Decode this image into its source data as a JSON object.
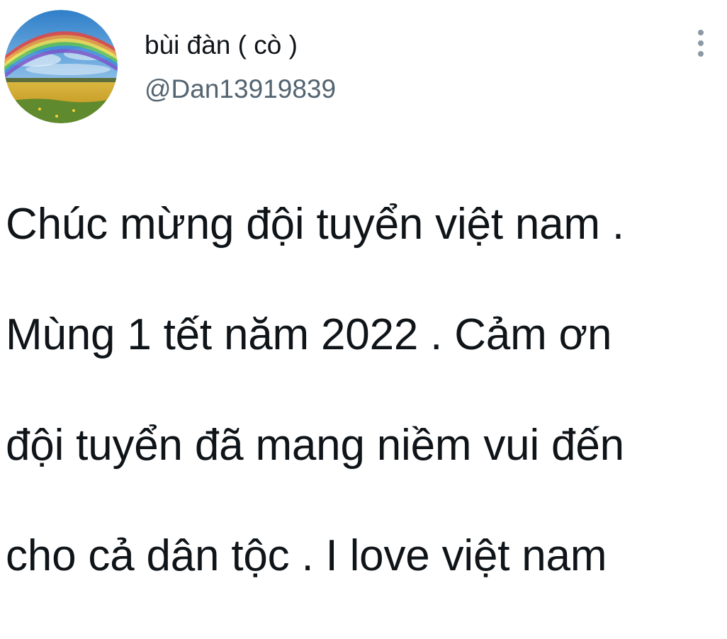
{
  "user": {
    "display_name": "bùi đàn ( cò )",
    "handle": "@Dan13919839",
    "avatar_icon": "rainbow-field-avatar"
  },
  "menu": {
    "icon": "more-vertical-icon"
  },
  "tweet": {
    "lines": [
      "Chúc mừng đội tuyển việt nam .",
      "Mùng 1 tết năm 2022 . Cảm ơn",
      "đội tuyển đã mang niềm vui đến",
      "cho cả dân tộc . I love việt nam"
    ]
  },
  "colors": {
    "text_primary": "#0f1419",
    "text_secondary": "#536471",
    "icon_gray": "#8b98a5",
    "background": "#ffffff"
  }
}
